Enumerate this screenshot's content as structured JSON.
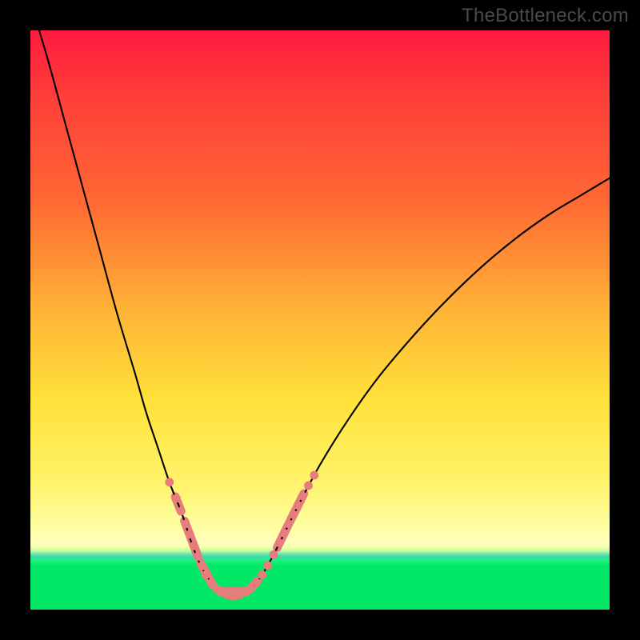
{
  "watermark": "TheBottleneck.com",
  "colors": {
    "gradient_top": "#ff1a3e",
    "gradient_mid": "#ffe23a",
    "gradient_green": "#00e865",
    "curve": "#000000",
    "markers": "#e77c7d",
    "frame": "#000000"
  },
  "chart_data": {
    "type": "line",
    "title": "",
    "xlabel": "",
    "ylabel": "",
    "xlim": [
      0,
      100
    ],
    "ylim": [
      0,
      100
    ],
    "grid": false,
    "legend": false,
    "series": [
      {
        "name": "bottleneck-curve",
        "x": [
          0,
          3,
          6,
          9,
          12,
          15,
          18,
          20,
          22,
          24,
          26,
          27,
          28,
          29,
          30,
          31,
          32,
          33,
          34,
          35,
          36,
          38,
          40,
          42,
          44,
          46,
          50,
          55,
          60,
          65,
          70,
          75,
          80,
          85,
          90,
          95,
          100
        ],
        "y": [
          105,
          95,
          84,
          73,
          62,
          51,
          41,
          34,
          28,
          22,
          17,
          14,
          11,
          8.5,
          6.5,
          5,
          3.8,
          3,
          2.5,
          2.3,
          2.5,
          3.5,
          6,
          9.5,
          13.5,
          17.5,
          25,
          33,
          40,
          46,
          51.5,
          56.5,
          61,
          65,
          68.5,
          71.5,
          74.5
        ]
      }
    ],
    "markers": {
      "name": "highlighted-data-points",
      "color": "#e77c7d",
      "points": [
        {
          "x": 24.0,
          "y": 22.0
        },
        {
          "x": 25.2,
          "y": 19.2
        },
        {
          "x": 26.0,
          "y": 17.0
        },
        {
          "x": 26.8,
          "y": 14.8
        },
        {
          "x": 27.5,
          "y": 13.0
        },
        {
          "x": 28.2,
          "y": 11.0
        },
        {
          "x": 28.9,
          "y": 9.2
        },
        {
          "x": 29.6,
          "y": 7.5
        },
        {
          "x": 30.3,
          "y": 6.0
        },
        {
          "x": 31.2,
          "y": 4.6
        },
        {
          "x": 32.1,
          "y": 3.6
        },
        {
          "x": 33.0,
          "y": 3.0
        },
        {
          "x": 34.0,
          "y": 2.5
        },
        {
          "x": 35.0,
          "y": 2.3
        },
        {
          "x": 36.0,
          "y": 2.5
        },
        {
          "x": 37.0,
          "y": 3.0
        },
        {
          "x": 38.0,
          "y": 3.6
        },
        {
          "x": 39.0,
          "y": 4.7
        },
        {
          "x": 40.0,
          "y": 6.0
        },
        {
          "x": 41.0,
          "y": 7.6
        },
        {
          "x": 42.0,
          "y": 9.5
        },
        {
          "x": 43.0,
          "y": 11.5
        },
        {
          "x": 43.8,
          "y": 13.2
        },
        {
          "x": 44.6,
          "y": 14.8
        },
        {
          "x": 45.4,
          "y": 16.4
        },
        {
          "x": 46.2,
          "y": 18.0
        },
        {
          "x": 47.0,
          "y": 19.6
        },
        {
          "x": 48.0,
          "y": 21.4
        },
        {
          "x": 49.0,
          "y": 23.2
        }
      ]
    },
    "highlight_segments": [
      {
        "from": {
          "x": 25.0,
          "y": 19.5
        },
        "to": {
          "x": 26.0,
          "y": 17.0
        }
      },
      {
        "from": {
          "x": 26.6,
          "y": 15.3
        },
        "to": {
          "x": 28.8,
          "y": 9.5
        }
      },
      {
        "from": {
          "x": 29.3,
          "y": 8.2
        },
        "to": {
          "x": 31.4,
          "y": 4.4
        }
      },
      {
        "from": {
          "x": 32.8,
          "y": 3.1
        },
        "to": {
          "x": 37.3,
          "y": 3.1
        }
      },
      {
        "from": {
          "x": 38.2,
          "y": 3.8
        },
        "to": {
          "x": 39.2,
          "y": 4.9
        }
      },
      {
        "from": {
          "x": 42.6,
          "y": 10.7
        },
        "to": {
          "x": 44.4,
          "y": 14.4
        }
      },
      {
        "from": {
          "x": 44.8,
          "y": 15.2
        },
        "to": {
          "x": 47.2,
          "y": 20.0
        }
      }
    ]
  }
}
